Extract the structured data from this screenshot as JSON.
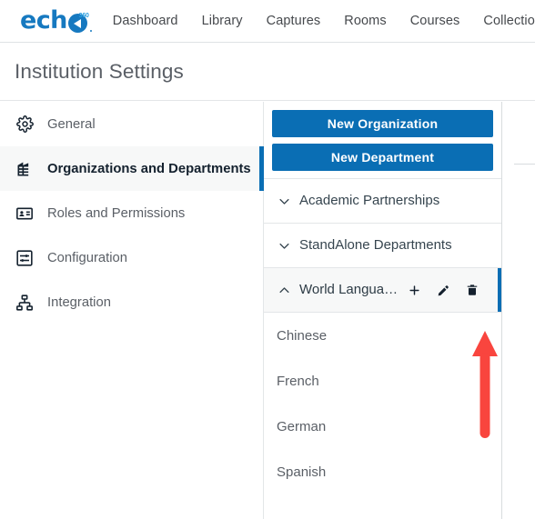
{
  "topnav": {
    "logo": {
      "name": "echo360",
      "word": "ech",
      "sup": "360"
    },
    "items": [
      {
        "label": "Dashboard",
        "name": "nav-item-dashboard"
      },
      {
        "label": "Library",
        "name": "nav-item-library"
      },
      {
        "label": "Captures",
        "name": "nav-item-captures"
      },
      {
        "label": "Rooms",
        "name": "nav-item-rooms"
      },
      {
        "label": "Courses",
        "name": "nav-item-courses"
      },
      {
        "label": "Collections",
        "name": "nav-item-collections"
      }
    ]
  },
  "page": {
    "title": "Institution Settings"
  },
  "settings_nav": {
    "items": [
      {
        "label": "General",
        "icon": "gear-icon",
        "active": false
      },
      {
        "label": "Organizations and Departments",
        "icon": "building-icon",
        "active": true
      },
      {
        "label": "Roles and Permissions",
        "icon": "id-card-icon",
        "active": false
      },
      {
        "label": "Configuration",
        "icon": "sliders-icon",
        "active": false
      },
      {
        "label": "Integration",
        "icon": "sitemap-icon",
        "active": false
      }
    ]
  },
  "tree_panel": {
    "buttons": [
      {
        "label": "New Organization",
        "name": "new-organization-button"
      },
      {
        "label": "New Department",
        "name": "new-department-button"
      }
    ],
    "rows": [
      {
        "label": "Academic Partnerships",
        "expanded": false,
        "selected": false
      },
      {
        "label": "StandAlone Departments",
        "expanded": false,
        "selected": false
      },
      {
        "label": "World Langua…",
        "expanded": true,
        "selected": true,
        "actions": [
          {
            "icon": "plus-icon",
            "name": "add-department-icon"
          },
          {
            "icon": "pencil-icon",
            "name": "edit-department-icon"
          },
          {
            "icon": "trash-icon",
            "name": "delete-department-icon"
          }
        ]
      }
    ],
    "children": [
      {
        "label": "Chinese"
      },
      {
        "label": "French"
      },
      {
        "label": "German"
      },
      {
        "label": "Spanish"
      }
    ]
  },
  "annotation": {
    "arrow": {
      "name": "red-arrow-annotation",
      "color": "#f9453e",
      "points_to": "delete-department-icon"
    }
  },
  "colors": {
    "accent_blue": "#0a6eb4",
    "logo_blue": "#1679c0",
    "text_dark": "#14212e",
    "text_muted": "#5a5f66",
    "annotation_red": "#f9453e",
    "selected_bg": "#f7f8f8",
    "border": "#e3e6e8"
  }
}
